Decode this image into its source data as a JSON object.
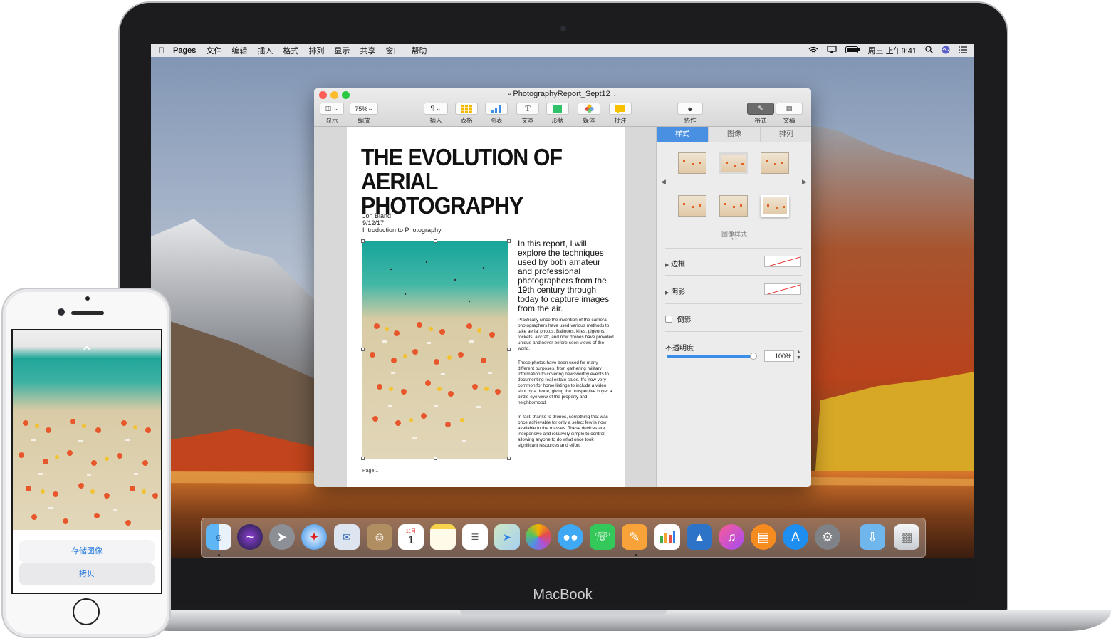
{
  "menubar": {
    "app_name": "Pages",
    "menus": [
      "文件",
      "编辑",
      "插入",
      "格式",
      "排列",
      "显示",
      "共享",
      "窗口",
      "帮助"
    ],
    "clock": "周三 上午9:41",
    "icons": [
      "apple-icon",
      "wifi-icon",
      "airplay-icon",
      "battery-icon",
      "search-icon",
      "siri-icon",
      "list-icon"
    ]
  },
  "window": {
    "title": "PhotographyReport_Sept12",
    "toolbar": {
      "view": "显示",
      "zoom_value": "75%",
      "zoom": "缩放",
      "insert": "插入",
      "table": "表格",
      "chart": "图表",
      "text": "文本",
      "shape": "形状",
      "media": "媒体",
      "comment": "批注",
      "collaborate": "协作",
      "format": "格式",
      "document": "文稿"
    },
    "doc": {
      "title_line1": "THE EVOLUTION OF",
      "title_line2": "AERIAL PHOTOGRAPHY",
      "author": "Jon Bland",
      "date": "9/12/17",
      "course": "Introduction to Photography",
      "intro": "In this report, I will explore the techniques used by both amateur and professional photographers from the 19th century through today to capture images from the air.",
      "para1": "Practically since the invention of the camera, photographers have used various methods to take aerial photos. Balloons, kites, pigeons, rockets, aircraft, and now drones have provided unique and never-before-seen views of the world.",
      "para2": "These photos have been used for many different purposes, from gathering military information to covering newsworthy events to documenting real estate sales. It's now very common for home listings to include a video shot by a drone, giving the prospective buyer a bird's-eye view of the property and neighborhood.",
      "para3": "In fact, thanks to drones, something that was once achievable for only a select few is now available to the masses. These devices are inexpensive and relatively simple to control, allowing anyone to do what once took significant resources and effort.",
      "page": "Page 1"
    },
    "inspector": {
      "tabs": [
        "样式",
        "图像",
        "排列"
      ],
      "styles_label": "图像样式",
      "border": "边框",
      "shadow": "阴影",
      "reflection": "倒影",
      "opacity": "不透明度",
      "opacity_value": "100%",
      "opacity_fraction": 1.0
    }
  },
  "dock": {
    "apps": [
      "finder-icon",
      "siri-icon",
      "launchpad-icon",
      "safari-icon",
      "mail-icon",
      "contacts-icon",
      "calendar-icon",
      "notes-icon",
      "reminders-icon",
      "maps-icon",
      "photos-icon",
      "messages-icon",
      "facetime-icon",
      "pages-icon",
      "numbers-icon",
      "keynote-icon",
      "itunes-icon",
      "ibooks-icon",
      "app-store-icon",
      "system-preferences-icon",
      "downloads-icon",
      "trash-icon"
    ],
    "calendar_month": "11月",
    "calendar_day": "1"
  },
  "macbook": {
    "label": "MacBook"
  },
  "iphone": {
    "save_image": "存储图像",
    "copy": "拷贝"
  },
  "colors": {
    "accent": "#4a90e2",
    "iphone_action": "#2a7de1"
  }
}
